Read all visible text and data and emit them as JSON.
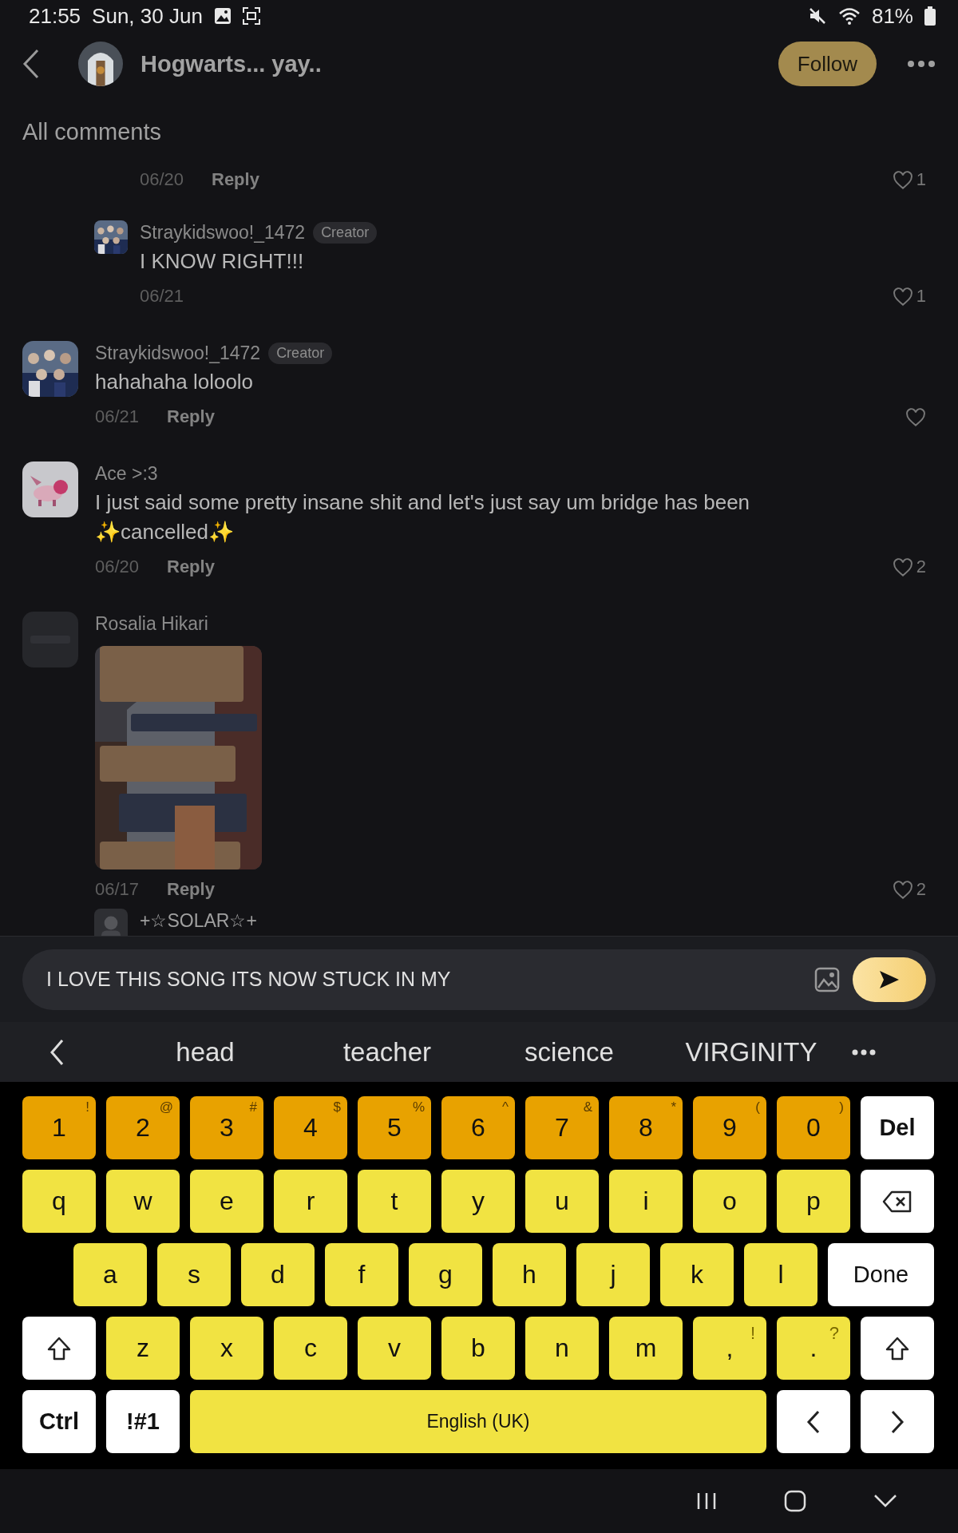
{
  "status_bar": {
    "time": "21:55",
    "date": "Sun, 30 Jun",
    "battery": "81%"
  },
  "header": {
    "title": "Hogwarts... yay..",
    "follow_button": "Follow"
  },
  "section_title": "All comments",
  "cut_top_row": {
    "date": "06/20",
    "action": "Reply",
    "likes": "1"
  },
  "comments": [
    {
      "kind": "reply",
      "author": "Straykidswoo!_1472",
      "badge": "Creator",
      "lines": [
        "I KNOW RIGHT!!!"
      ],
      "date": "06/21",
      "likes": "1"
    },
    {
      "kind": "comment",
      "author": "Straykidswoo!_1472",
      "badge": "Creator",
      "lines": [
        "hahahaha loloolo"
      ],
      "date": "06/21",
      "action": "Reply"
    },
    {
      "kind": "comment",
      "author": "Ace >:3",
      "lines": [
        "I just said some pretty insane shit and let's just say um bridge has been",
        "✨cancelled✨"
      ],
      "date": "06/20",
      "action": "Reply",
      "likes": "2"
    },
    {
      "kind": "comment",
      "author": "Rosalia Hikari",
      "date": "06/17",
      "action": "Reply",
      "likes": "2"
    }
  ],
  "cut_bottom_row": {
    "author": "+☆SOLAR☆+"
  },
  "composer": {
    "value": "I LOVE THIS SONG ITS NOW STUCK IN MY"
  },
  "suggestions": [
    "head",
    "teacher",
    "science",
    "VIRGINITY"
  ],
  "keyboard": [
    [
      {
        "kind": "num",
        "label": "1",
        "alt": "!"
      },
      {
        "kind": "num",
        "label": "2",
        "alt": "@"
      },
      {
        "kind": "num",
        "label": "3",
        "alt": "#"
      },
      {
        "kind": "num",
        "label": "4",
        "alt": "$"
      },
      {
        "kind": "num",
        "label": "5",
        "alt": "%"
      },
      {
        "kind": "num",
        "label": "6",
        "alt": "^"
      },
      {
        "kind": "num",
        "label": "7",
        "alt": "&"
      },
      {
        "kind": "num",
        "label": "8",
        "alt": "*"
      },
      {
        "kind": "num",
        "label": "9",
        "alt": "("
      },
      {
        "kind": "num",
        "label": "0",
        "alt": ")"
      },
      {
        "kind": "func",
        "label": "Del"
      }
    ],
    [
      {
        "kind": "letter",
        "label": "q"
      },
      {
        "kind": "letter",
        "label": "w"
      },
      {
        "kind": "letter",
        "label": "e"
      },
      {
        "kind": "letter",
        "label": "r"
      },
      {
        "kind": "letter",
        "label": "t"
      },
      {
        "kind": "letter",
        "label": "y"
      },
      {
        "kind": "letter",
        "label": "u"
      },
      {
        "kind": "letter",
        "label": "i"
      },
      {
        "kind": "letter",
        "label": "o"
      },
      {
        "kind": "letter",
        "label": "p"
      },
      {
        "kind": "backspace"
      }
    ],
    [
      {
        "kind": "letter",
        "label": "a"
      },
      {
        "kind": "letter",
        "label": "s"
      },
      {
        "kind": "letter",
        "label": "d"
      },
      {
        "kind": "letter",
        "label": "f"
      },
      {
        "kind": "letter",
        "label": "g"
      },
      {
        "kind": "letter",
        "label": "h"
      },
      {
        "kind": "letter",
        "label": "j"
      },
      {
        "kind": "letter",
        "label": "k"
      },
      {
        "kind": "letter",
        "label": "l"
      },
      {
        "kind": "wide",
        "label": "Done"
      }
    ],
    [
      {
        "kind": "shift"
      },
      {
        "kind": "letter",
        "label": "z"
      },
      {
        "kind": "letter",
        "label": "x"
      },
      {
        "kind": "letter",
        "label": "c"
      },
      {
        "kind": "letter",
        "label": "v"
      },
      {
        "kind": "letter",
        "label": "b"
      },
      {
        "kind": "letter",
        "label": "n"
      },
      {
        "kind": "letter",
        "label": "m"
      },
      {
        "kind": "letter",
        "label": ",",
        "alt": "!"
      },
      {
        "kind": "letter",
        "label": ".",
        "alt": "?"
      },
      {
        "kind": "shift"
      }
    ],
    [
      {
        "kind": "func",
        "label": "Ctrl"
      },
      {
        "kind": "func",
        "label": "!#1"
      },
      {
        "kind": "space",
        "label": "English (UK)"
      },
      {
        "kind": "left"
      },
      {
        "kind": "right"
      }
    ]
  ]
}
